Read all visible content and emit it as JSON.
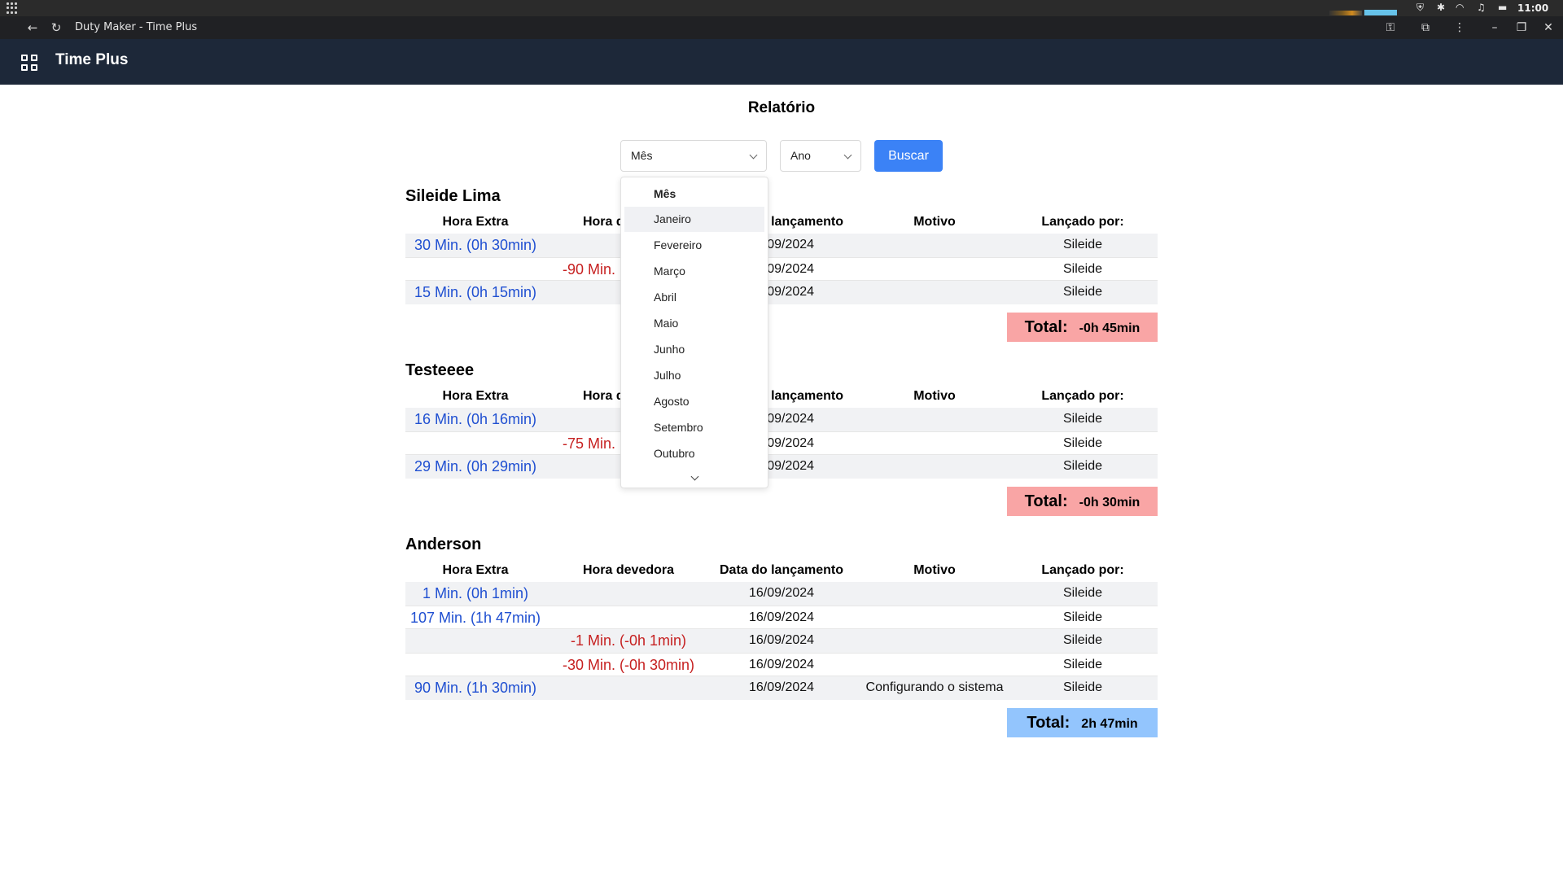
{
  "os": {
    "clock": "11:00"
  },
  "browser": {
    "window_title": "Duty Maker - Time Plus"
  },
  "app": {
    "title": "Time Plus"
  },
  "page": {
    "title": "Relatório"
  },
  "filters": {
    "month_value": "Mês",
    "year_value": "Ano",
    "search_label": "Buscar"
  },
  "month_dropdown": {
    "header": "Mês",
    "items": [
      "Janeiro",
      "Fevereiro",
      "Março",
      "Abril",
      "Maio",
      "Junho",
      "Julho",
      "Agosto",
      "Setembro",
      "Outubro"
    ],
    "hovered": "Janeiro"
  },
  "columns": {
    "extra": "Hora Extra",
    "debit": "Hora devedora",
    "date": "Data do lançamento",
    "reason": "Motivo",
    "author": "Lançado por:"
  },
  "sections": [
    {
      "name": "Sileide Lima",
      "rows": [
        {
          "extra": "30 Min.  (0h 30min)",
          "debit": "",
          "date": "16/09/2024",
          "reason": "",
          "author": "Sileide"
        },
        {
          "extra": "",
          "debit": "-90 Min.  (-1h 30min)",
          "date": "16/09/2024",
          "reason": "",
          "author": "Sileide"
        },
        {
          "extra": "15 Min.  (0h 15min)",
          "debit": "",
          "date": "16/09/2024",
          "reason": "",
          "author": "Sileide"
        }
      ],
      "total_label": "Total:",
      "total_value": "-0h 45min",
      "total_status": "negative"
    },
    {
      "name": "Testeeee",
      "rows": [
        {
          "extra": "16 Min.  (0h 16min)",
          "debit": "",
          "date": "16/09/2024",
          "reason": "",
          "author": "Sileide"
        },
        {
          "extra": "",
          "debit": "-75 Min.  (-1h 15min)",
          "date": "16/09/2024",
          "reason": "",
          "author": "Sileide"
        },
        {
          "extra": "29 Min.  (0h 29min)",
          "debit": "",
          "date": "16/09/2024",
          "reason": "",
          "author": "Sileide"
        }
      ],
      "total_label": "Total:",
      "total_value": "-0h 30min",
      "total_status": "negative"
    },
    {
      "name": "Anderson",
      "rows": [
        {
          "extra": "1 Min.  (0h 1min)",
          "debit": "",
          "date": "16/09/2024",
          "reason": "",
          "author": "Sileide"
        },
        {
          "extra": "107 Min.  (1h 47min)",
          "debit": "",
          "date": "16/09/2024",
          "reason": "",
          "author": "Sileide"
        },
        {
          "extra": "",
          "debit": "-1 Min.  (-0h 1min)",
          "date": "16/09/2024",
          "reason": "",
          "author": "Sileide"
        },
        {
          "extra": "",
          "debit": "-30 Min.  (-0h 30min)",
          "date": "16/09/2024",
          "reason": "",
          "author": "Sileide"
        },
        {
          "extra": "90 Min.  (1h 30min)",
          "debit": "",
          "date": "16/09/2024",
          "reason": "Configurando o sistema",
          "author": "Sileide"
        }
      ],
      "total_label": "Total:",
      "total_value": "2h 47min",
      "total_status": "positive"
    }
  ],
  "colors": {
    "header_bg": "#1d2839",
    "button_blue": "#3b82f6",
    "extra_text": "#1f4fd1",
    "debit_text": "#c62020",
    "total_negative": "#f9a5a5",
    "total_positive": "#93c5fd"
  }
}
